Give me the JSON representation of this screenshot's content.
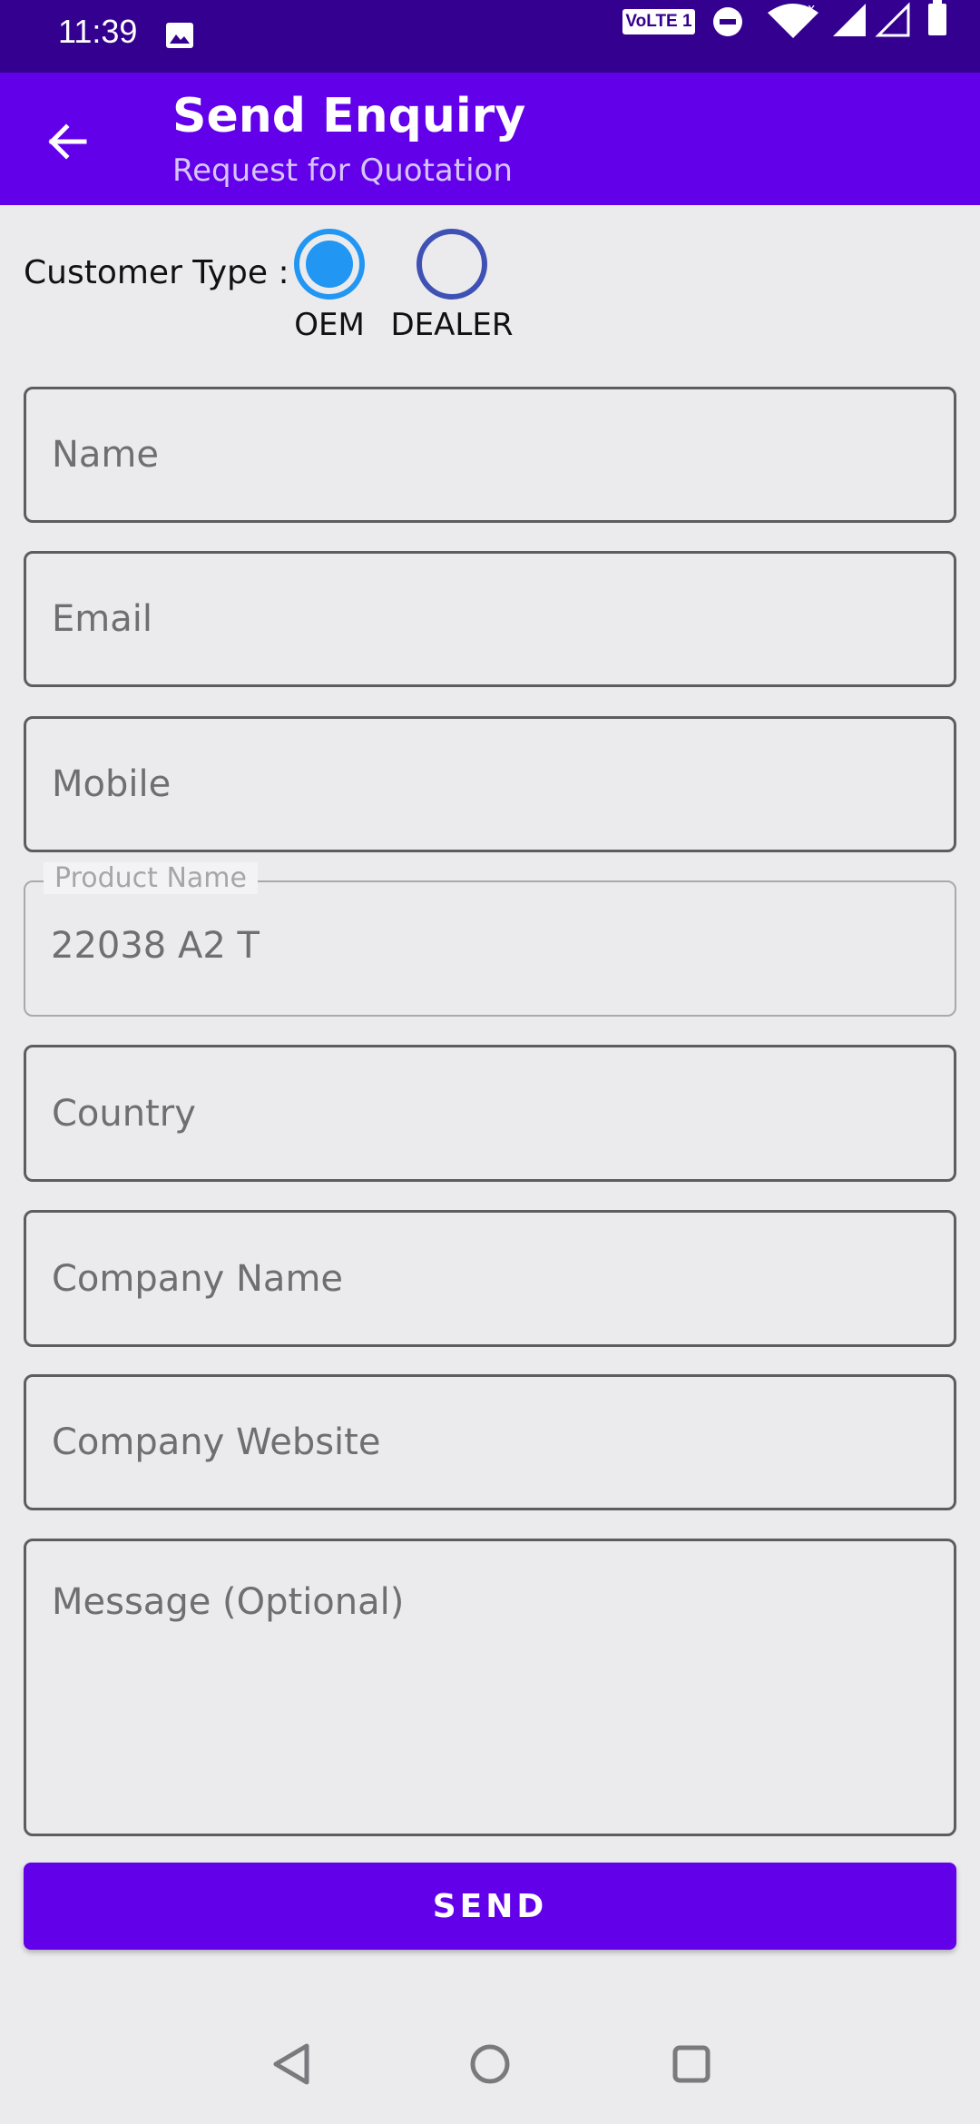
{
  "status": {
    "time": "11:39",
    "volte": "VoLTE 1"
  },
  "appbar": {
    "title": "Send Enquiry",
    "subtitle": "Request for Quotation"
  },
  "customer_type": {
    "label": "Customer Type :",
    "options": [
      {
        "label": "OEM",
        "checked": true
      },
      {
        "label": "DEALER",
        "checked": false
      }
    ]
  },
  "form": {
    "name_placeholder": "Name",
    "email_placeholder": "Email",
    "mobile_placeholder": "Mobile",
    "product_label": "Product Name",
    "product_value": "22038 A2 T",
    "country_placeholder": "Country",
    "company_name_placeholder": "Company Name",
    "company_website_placeholder": "Company Website",
    "message_placeholder": "Message (Optional)"
  },
  "send_label": "SEND",
  "colors": {
    "status_bar": "#34008F",
    "app_bar": "#6200EA",
    "radio_checked": "#2196F3",
    "radio_unchecked": "#3F51B5",
    "background": "#EBEBEE"
  },
  "icons": {
    "back": "arrow-left-icon",
    "status": [
      "image-icon",
      "do-not-disturb-icon",
      "wifi-icon",
      "signal-icon",
      "signal-empty-icon",
      "battery-icon"
    ],
    "nav": [
      "back-triangle-icon",
      "home-circle-icon",
      "recents-square-icon"
    ]
  }
}
